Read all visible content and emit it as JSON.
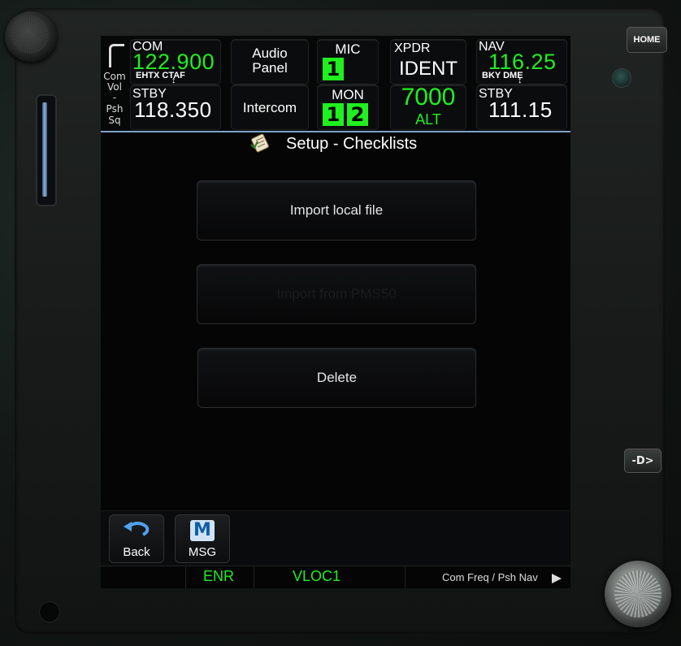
{
  "bezel": {
    "home_label": "HOME",
    "direct_to_label": "-D>"
  },
  "topbar": {
    "com_vol": {
      "line1": "Com",
      "line2": "Vol",
      "line3": "-",
      "line4": "Psh",
      "line5": "Sq"
    },
    "com": {
      "label": "COM",
      "active_freq": "122.900",
      "active_id": "EHTX CTAF",
      "swap_arrow": "↕",
      "stby_label": "STBY",
      "stby_freq": "118.350"
    },
    "audio_panel": {
      "line1": "Audio",
      "line2": "Panel"
    },
    "intercom": "Intercom",
    "mic": {
      "label": "MIC",
      "value": "1"
    },
    "mon": {
      "label": "MON",
      "values": [
        "1",
        "2"
      ]
    },
    "xpdr": {
      "label": "XPDR",
      "mode": "IDENT",
      "code": "7000",
      "alt": "ALT"
    },
    "nav": {
      "label": "NAV",
      "active_freq": "116.25",
      "active_id": "BKY DME",
      "swap_arrow": "↕",
      "stby_label": "STBY",
      "stby_freq": "111.15"
    }
  },
  "page": {
    "title": "Setup - Checklists",
    "buttons": [
      {
        "label": "Import local file",
        "enabled": true
      },
      {
        "label": "Import from PMS50",
        "enabled": false
      },
      {
        "label": "Delete",
        "enabled": true
      }
    ]
  },
  "softkeys": {
    "back": "Back",
    "msg": "MSG",
    "msg_icon": "M"
  },
  "status": {
    "mode": "ENR",
    "nav_source": "VLOC1",
    "hint": "Com Freq / Psh Nav"
  },
  "colors": {
    "accent_green": "#1ff01f",
    "separator_blue": "#7ea3c7"
  }
}
